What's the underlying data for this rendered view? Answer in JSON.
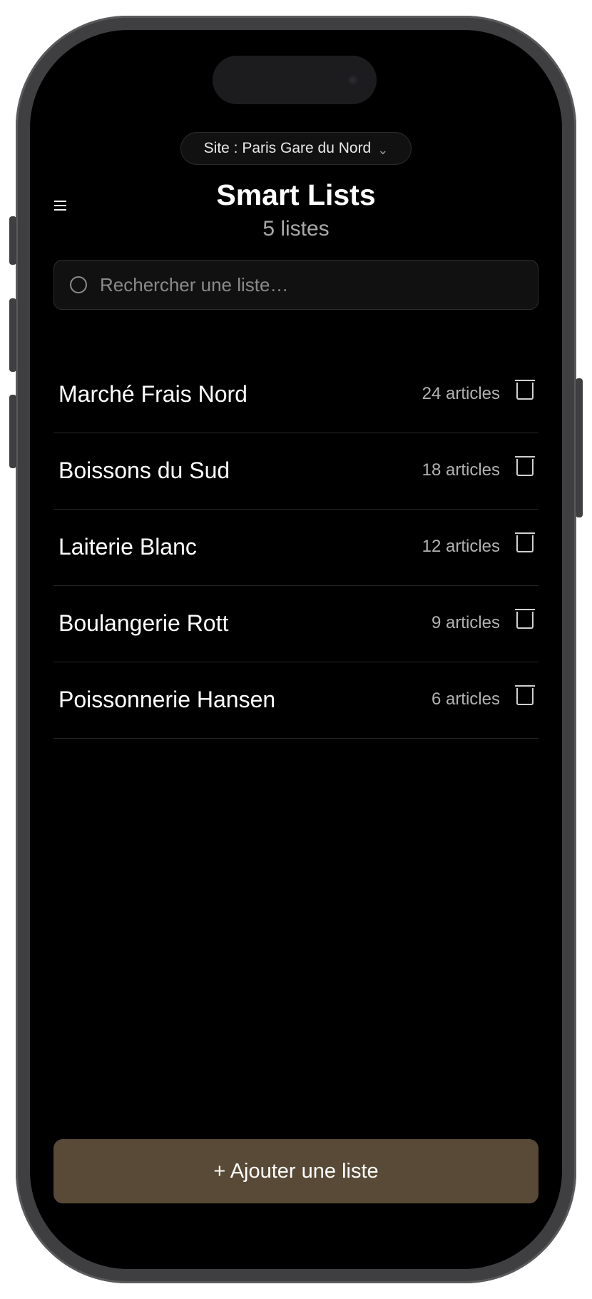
{
  "header": {
    "site_label": "Site : Paris Gare du Nord",
    "site_chevron": "⌄",
    "title": "Smart Lists",
    "subtitle": "5 listes"
  },
  "search": {
    "placeholder": "Rechercher une liste…",
    "value": ""
  },
  "lists": [
    {
      "name": "Marché Frais Nord",
      "count": "24 articles"
    },
    {
      "name": "Boissons du Sud",
      "count": "18 articles"
    },
    {
      "name": "Laiterie Blanc",
      "count": "12 articles"
    },
    {
      "name": "Boulangerie Rott",
      "count": "9 articles"
    },
    {
      "name": "Poissonnerie Hansen",
      "count": "6 articles"
    }
  ],
  "footer": {
    "add_label": "+ Ajouter une liste"
  },
  "icons": {
    "menu": "menu-icon",
    "search": "search-icon",
    "delete": "trash-icon"
  },
  "colors": {
    "background": "#000000",
    "accent_button": "#584a36",
    "secondary_text": "#a8a8a8",
    "divider": "#262626"
  }
}
